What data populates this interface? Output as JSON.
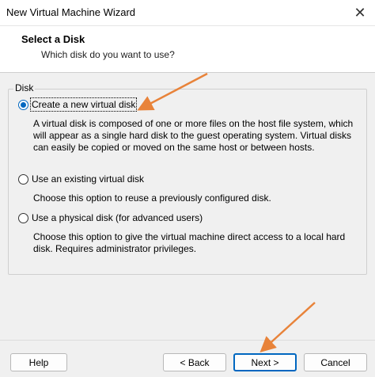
{
  "window": {
    "title": "New Virtual Machine Wizard"
  },
  "header": {
    "title": "Select a Disk",
    "subtitle": "Which disk do you want to use?"
  },
  "group": {
    "label": "Disk",
    "options": [
      {
        "label": "Create a new virtual disk",
        "selected": true,
        "description": "A virtual disk is composed of one or more files on the host file system, which will appear as a single hard disk to the guest operating system. Virtual disks can easily be copied or moved on the same host or between hosts."
      },
      {
        "label": "Use an existing virtual disk",
        "selected": false,
        "description": "Choose this option to reuse a previously configured disk."
      },
      {
        "label": "Use a physical disk (for advanced users)",
        "selected": false,
        "description": "Choose this option to give the virtual machine direct access to a local hard disk. Requires administrator privileges."
      }
    ]
  },
  "footer": {
    "help": "Help",
    "back": "< Back",
    "next": "Next >",
    "cancel": "Cancel"
  },
  "colors": {
    "accent": "#0067c0",
    "annotation": "#e8833a"
  },
  "icons": {
    "close": "close-icon"
  }
}
